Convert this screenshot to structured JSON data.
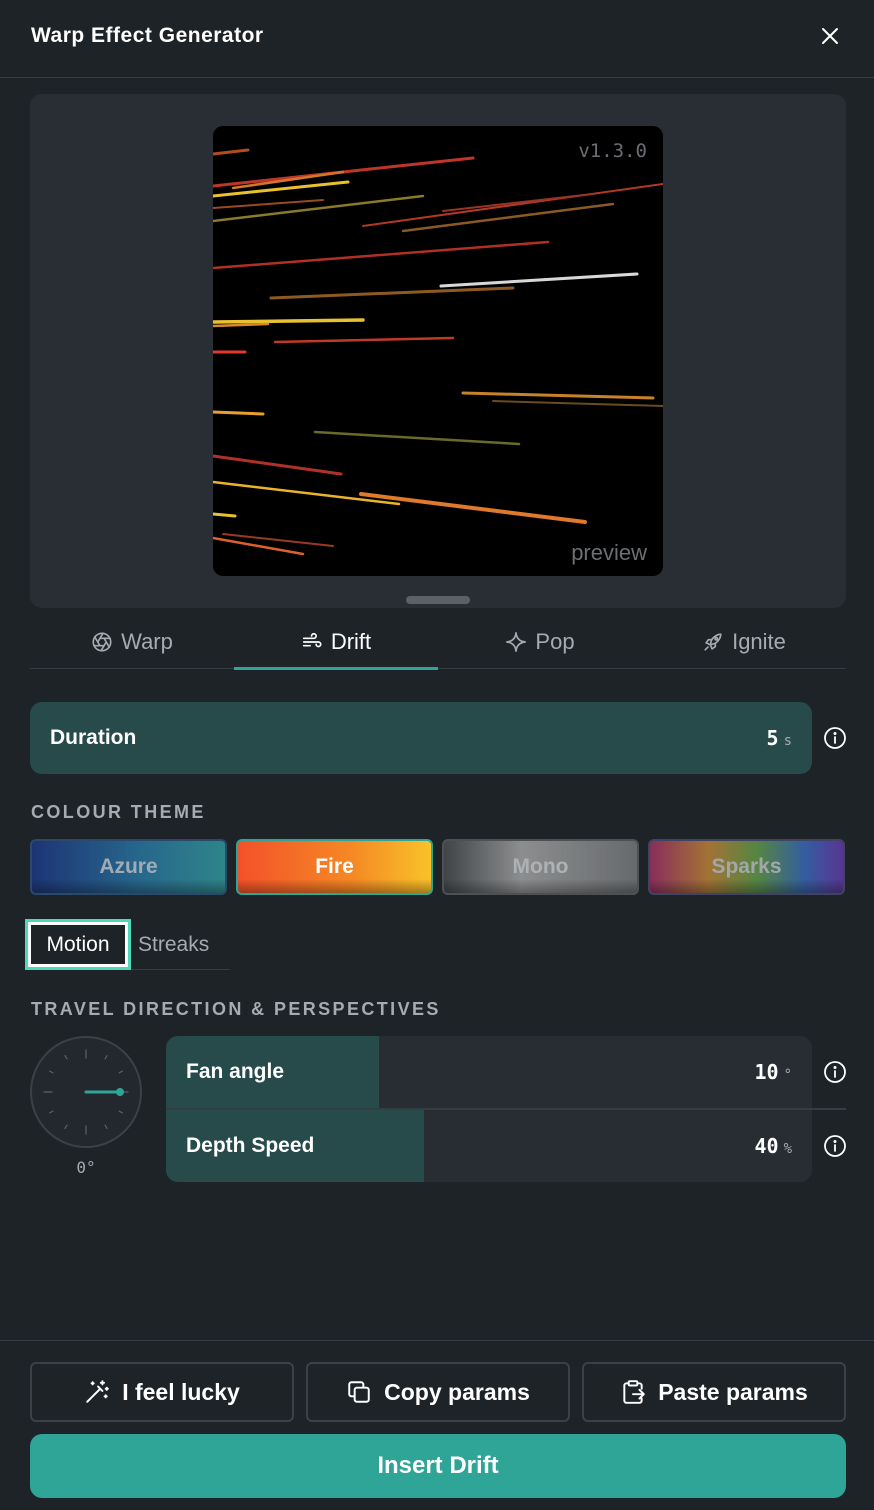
{
  "header": {
    "title": "Warp Effect Generator"
  },
  "preview": {
    "version": "v1.3.0",
    "label": "preview"
  },
  "tabs": [
    {
      "label": "Warp",
      "icon": "aperture-icon"
    },
    {
      "label": "Drift",
      "icon": "wind-icon"
    },
    {
      "label": "Pop",
      "icon": "sparkle-icon"
    },
    {
      "label": "Ignite",
      "icon": "rocket-icon"
    }
  ],
  "active_tab": "Drift",
  "duration": {
    "label": "Duration",
    "value": "5",
    "unit": "s"
  },
  "colour_theme": {
    "label": "COLOUR THEME",
    "options": [
      "Azure",
      "Fire",
      "Mono",
      "Sparks"
    ],
    "selected": "Fire"
  },
  "subtabs": {
    "items": [
      "Motion",
      "Streaks"
    ],
    "selected": "Motion"
  },
  "travel": {
    "label": "TRAVEL DIRECTION & PERSPECTIVES",
    "dial_value": "0°",
    "dial_degrees": 0,
    "fan_angle": {
      "label": "Fan angle",
      "value": "10",
      "unit": "°",
      "fill_percent": 33
    },
    "depth_speed": {
      "label": "Depth Speed",
      "value": "40",
      "unit": "%",
      "fill_percent": 40
    }
  },
  "actions": {
    "lucky": "I feel lucky",
    "copy": "Copy params",
    "paste": "Paste params",
    "insert": "Insert Drift"
  },
  "colors": {
    "accent": "#2ea596",
    "fill": "#274a4b",
    "background": "#1e2327",
    "panel": "#282e33"
  }
}
